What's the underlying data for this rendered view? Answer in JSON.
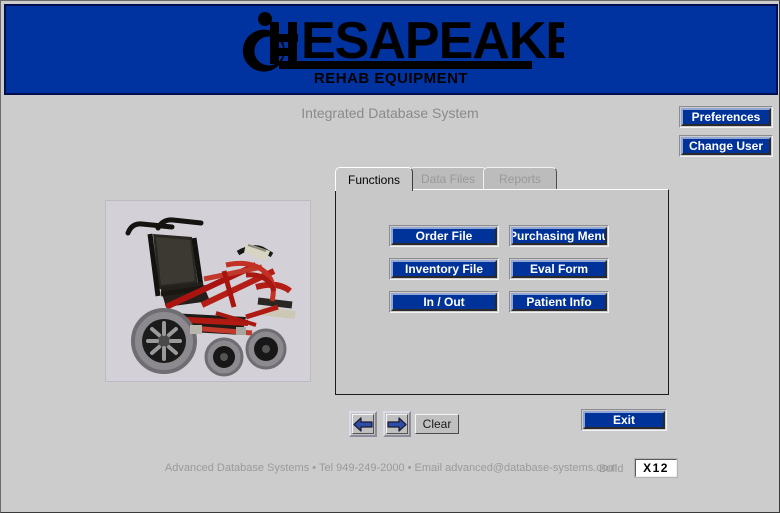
{
  "header": {
    "brand_text": "ESAPEAKE",
    "brand_full": "CHESAPEAKE",
    "tagline": "REHAB EQUIPMENT",
    "banner_color": "#0033a0",
    "logo_icon": "wheelchair-accessibility-icon"
  },
  "subtitle": "Integrated Database System",
  "top_buttons": [
    {
      "label": "Preferences"
    },
    {
      "label": "Change User"
    }
  ],
  "image_panel": {
    "alt": "power-wheelchair-photo",
    "frame_color": "#d3d0d8"
  },
  "tabs": [
    {
      "label": "Functions",
      "active": true,
      "disabled": false
    },
    {
      "label": "Data Files",
      "active": false,
      "disabled": true
    },
    {
      "label": "Reports",
      "active": false,
      "disabled": true
    }
  ],
  "functions": {
    "buttons": [
      {
        "label": "Order File"
      },
      {
        "label": "Purchasing Menu"
      },
      {
        "label": "Inventory File"
      },
      {
        "label": "Eval Form"
      },
      {
        "label": "In / Out"
      },
      {
        "label": "Patient Info"
      }
    ]
  },
  "navigation": {
    "prev_icon": "arrow-left-icon",
    "next_icon": "arrow-right-icon",
    "clear_label": "Clear",
    "exit_label": "Exit"
  },
  "footer": {
    "company": "Advanced Database Systems",
    "separator": "•",
    "phone_label": "Tel",
    "phone": "949-249-2000",
    "email_label": "Email",
    "email": "advanced@database-systems.com",
    "credits": "Advanced Database Systems • Tel 949-249-2000 • Email advanced@database-systems.com",
    "build_label": "Build",
    "build_value": "X12"
  },
  "colors": {
    "banner_blue": "#0033a0",
    "button_navy": "#003399",
    "page_gray": "#cccccc",
    "panel_gray": "#c8c8c8",
    "muted_text": "#9a9a9a"
  }
}
